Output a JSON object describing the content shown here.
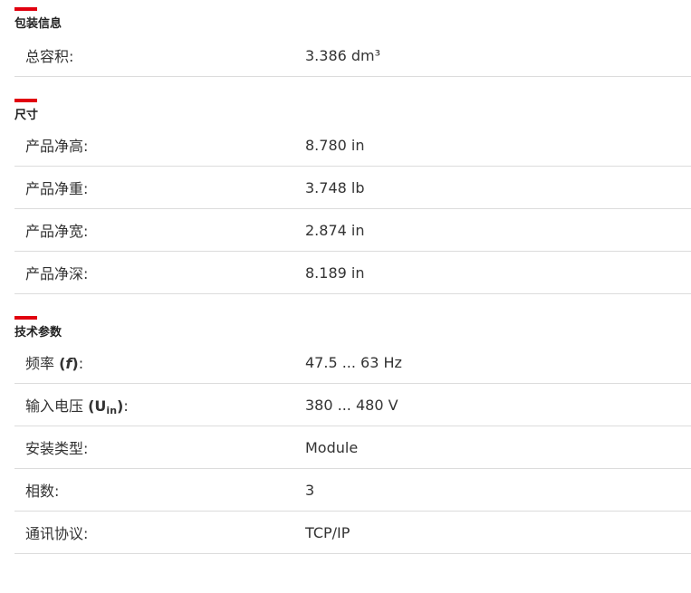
{
  "sections": [
    {
      "title": "包装信息",
      "rows": [
        {
          "label": "总容积:",
          "value": "3.386 dm³"
        }
      ]
    },
    {
      "title": "尺寸",
      "rows": [
        {
          "label": "产品净高:",
          "value": "8.780 in"
        },
        {
          "label": "产品净重:",
          "value": "3.748 lb"
        },
        {
          "label": "产品净宽:",
          "value": "2.874 in"
        },
        {
          "label": "产品净深:",
          "value": "8.189 in"
        }
      ]
    },
    {
      "title": "技术参数",
      "rows": [
        {
          "label_main": "频率",
          "label_symbol": "f",
          "value": "47.5 ... 63 Hz"
        },
        {
          "label_main": "输入电压",
          "label_symbol": "U",
          "label_sub": "in",
          "value": "380 ... 480 V"
        },
        {
          "label": "安装类型:",
          "value": "Module"
        },
        {
          "label": "相数:",
          "value": "3"
        },
        {
          "label": "通讯协议:",
          "value": "TCP/IP"
        }
      ]
    }
  ],
  "colors": {
    "accent": "#e1000f",
    "divider": "#dcdcdc",
    "text": "#333333"
  }
}
